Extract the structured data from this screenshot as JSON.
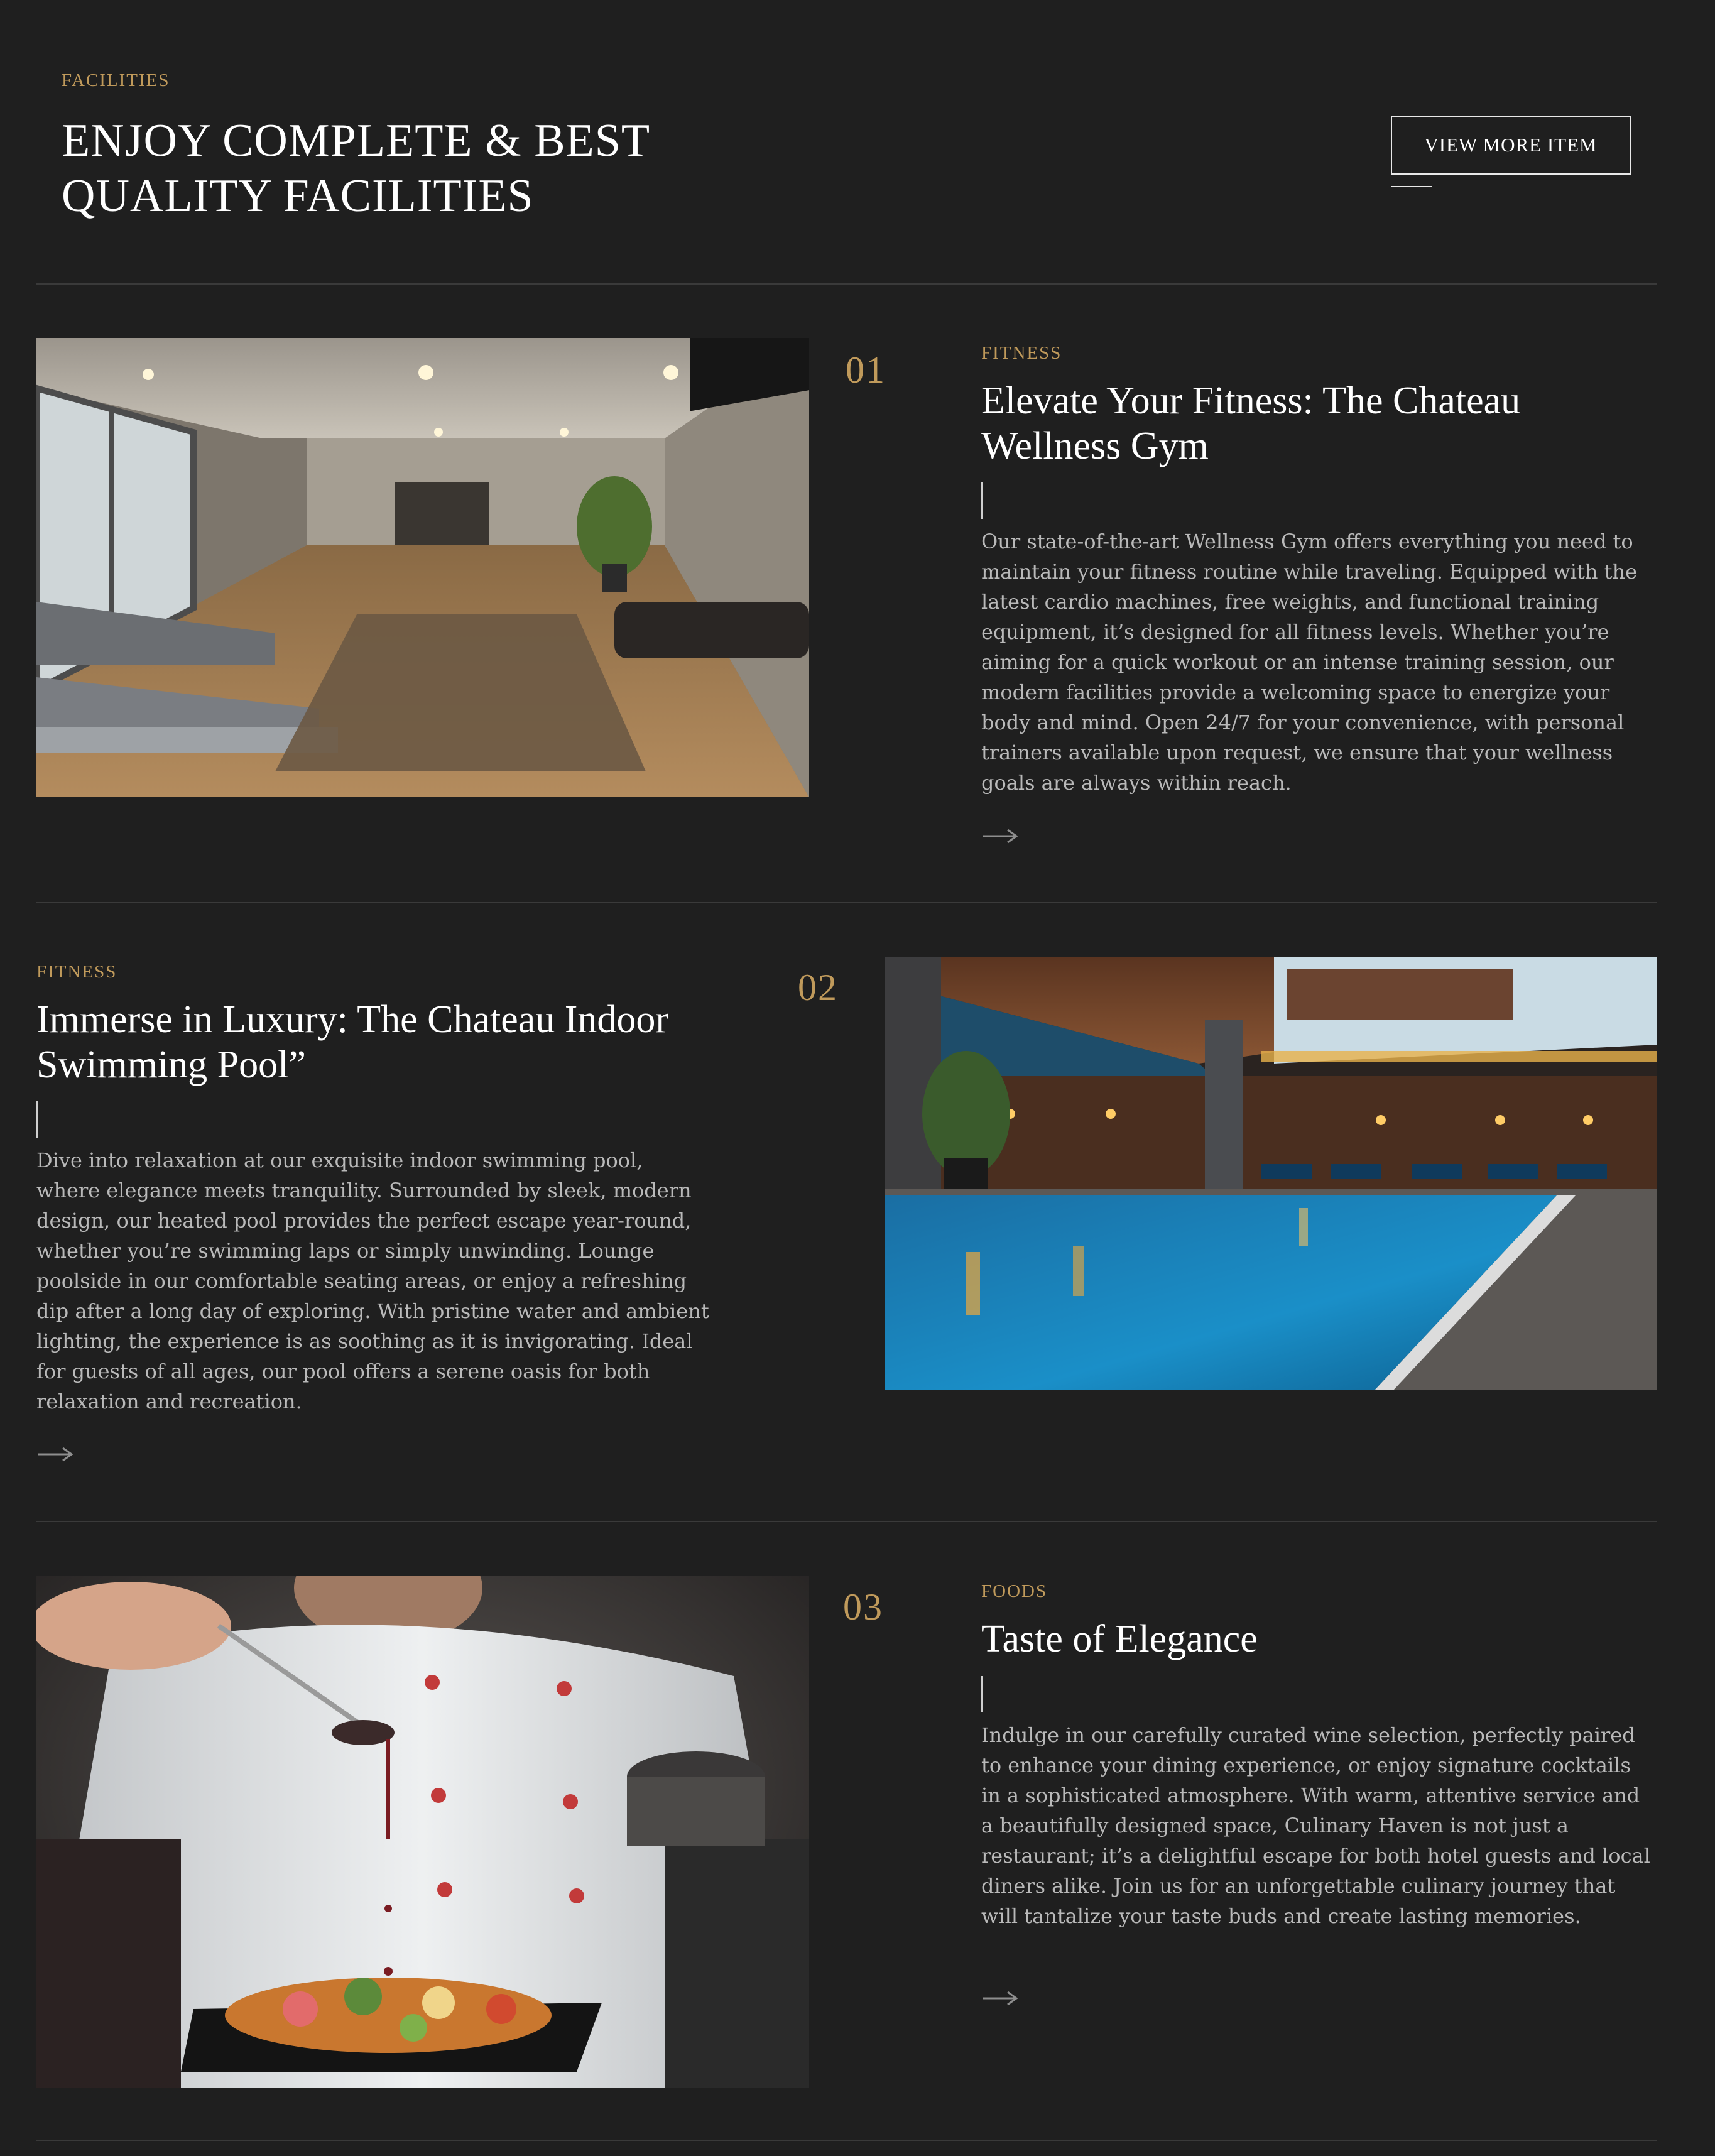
{
  "header": {
    "eyebrow": "FACILITIES",
    "title_line1": "ENJOY COMPLETE & BEST",
    "title_line2": "QUALITY FACILITIES",
    "button_label": "VIEW MORE ITEM"
  },
  "items": [
    {
      "number": "01",
      "category": "FITNESS",
      "title_line1": "Elevate Your Fitness: The Chateau",
      "title_line2": "Wellness Gym",
      "description": "Our state-of-the-art Wellness Gym offers everything you need to maintain your fitness routine while traveling. Equipped with the latest cardio machines, free weights, and functional training equipment, it’s designed for all fitness levels. Whether you’re aiming for a quick workout or an intense training session, our modern facilities provide a welcoming space to energize your body and mind. Open 24/7 for your convenience, with personal trainers available upon request, we ensure that your wellness goals are always within reach.",
      "image_icon": "gym-photo"
    },
    {
      "number": "02",
      "category": "FITNESS",
      "title_line1": "Immerse in Luxury: The Chateau Indoor",
      "title_line2": "Swimming Pool”",
      "description": "Dive into relaxation at our exquisite indoor swimming pool, where elegance meets tranquility. Surrounded by sleek, modern design, our heated pool provides the perfect escape year-round, whether you’re swimming laps or simply unwinding. Lounge poolside in our comfortable seating areas, or enjoy a refreshing dip after a long day of exploring. With pristine water and ambient lighting, the experience is as soothing as it is invigorating. Ideal for guests of all ages, our pool offers a serene oasis for both relaxation and recreation.",
      "image_icon": "pool-photo"
    },
    {
      "number": "03",
      "category": "FOODS",
      "title_line1": "Taste of Elegance",
      "title_line2": "",
      "description": "Indulge in our carefully curated wine selection, perfectly paired to enhance your dining experience, or enjoy signature cocktails in a sophisticated atmosphere. With warm, attentive service and a beautifully designed space, Culinary Haven is not just a restaurant; it’s a delightful escape for both hotel guests and local diners alike. Join us for an unforgettable culinary journey that will tantalize your taste buds and create lasting memories.",
      "image_icon": "chef-plating-photo"
    }
  ],
  "colors": {
    "background": "#1f1f1f",
    "accent_gold": "#c09a5b",
    "body_text": "#b9b9b9",
    "divider": "#3a3a3a"
  }
}
